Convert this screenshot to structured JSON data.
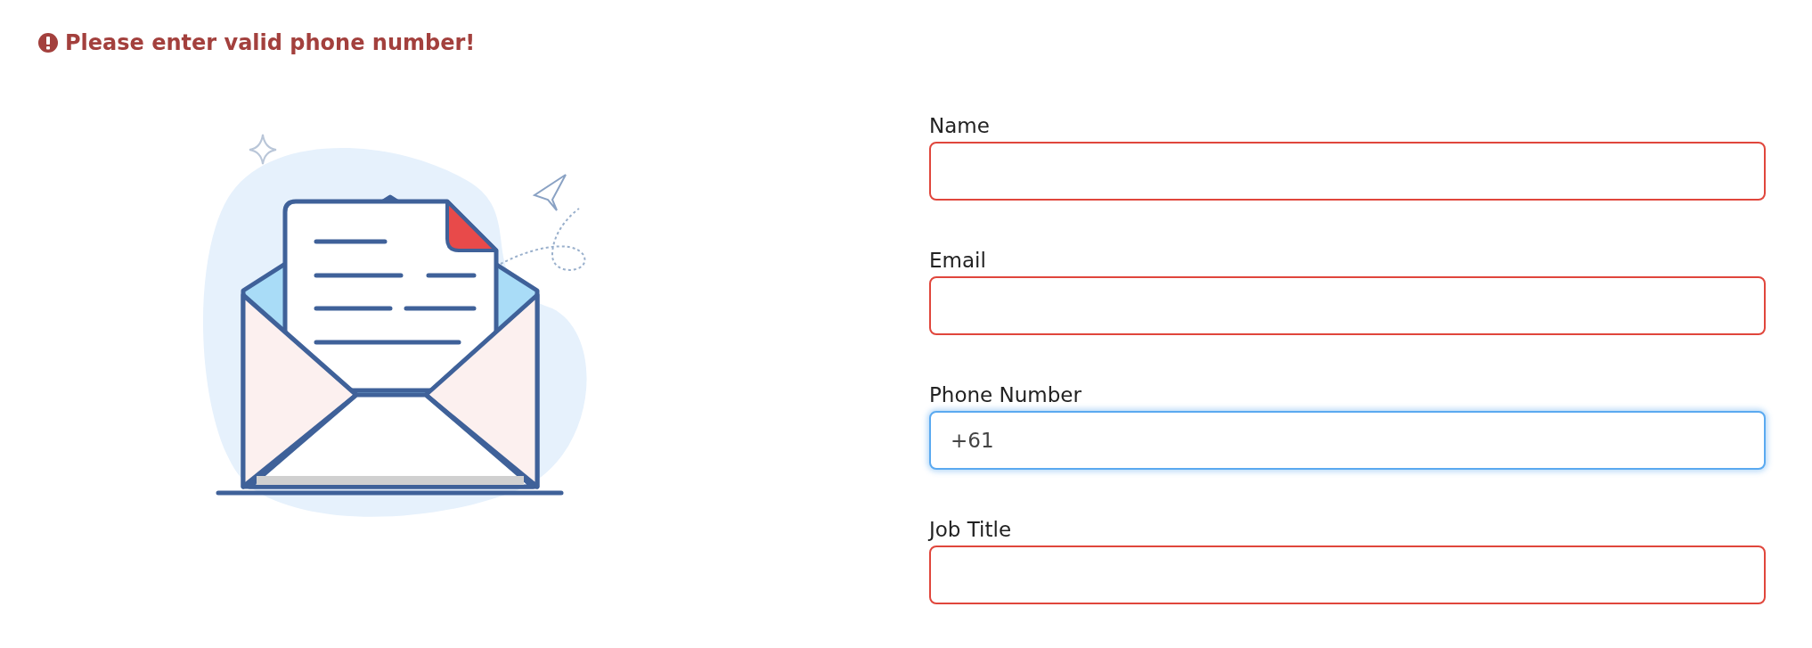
{
  "error_message": {
    "text": "Please enter valid phone number!"
  },
  "form": {
    "fields": [
      {
        "label": "Name",
        "invalid": true,
        "focused": false
      },
      {
        "label": "Email",
        "invalid": true,
        "focused": false
      },
      {
        "label": "Phone Number",
        "value": "+61",
        "invalid": false,
        "focused": true
      },
      {
        "label": "Job Title",
        "invalid": true,
        "focused": false
      }
    ]
  }
}
